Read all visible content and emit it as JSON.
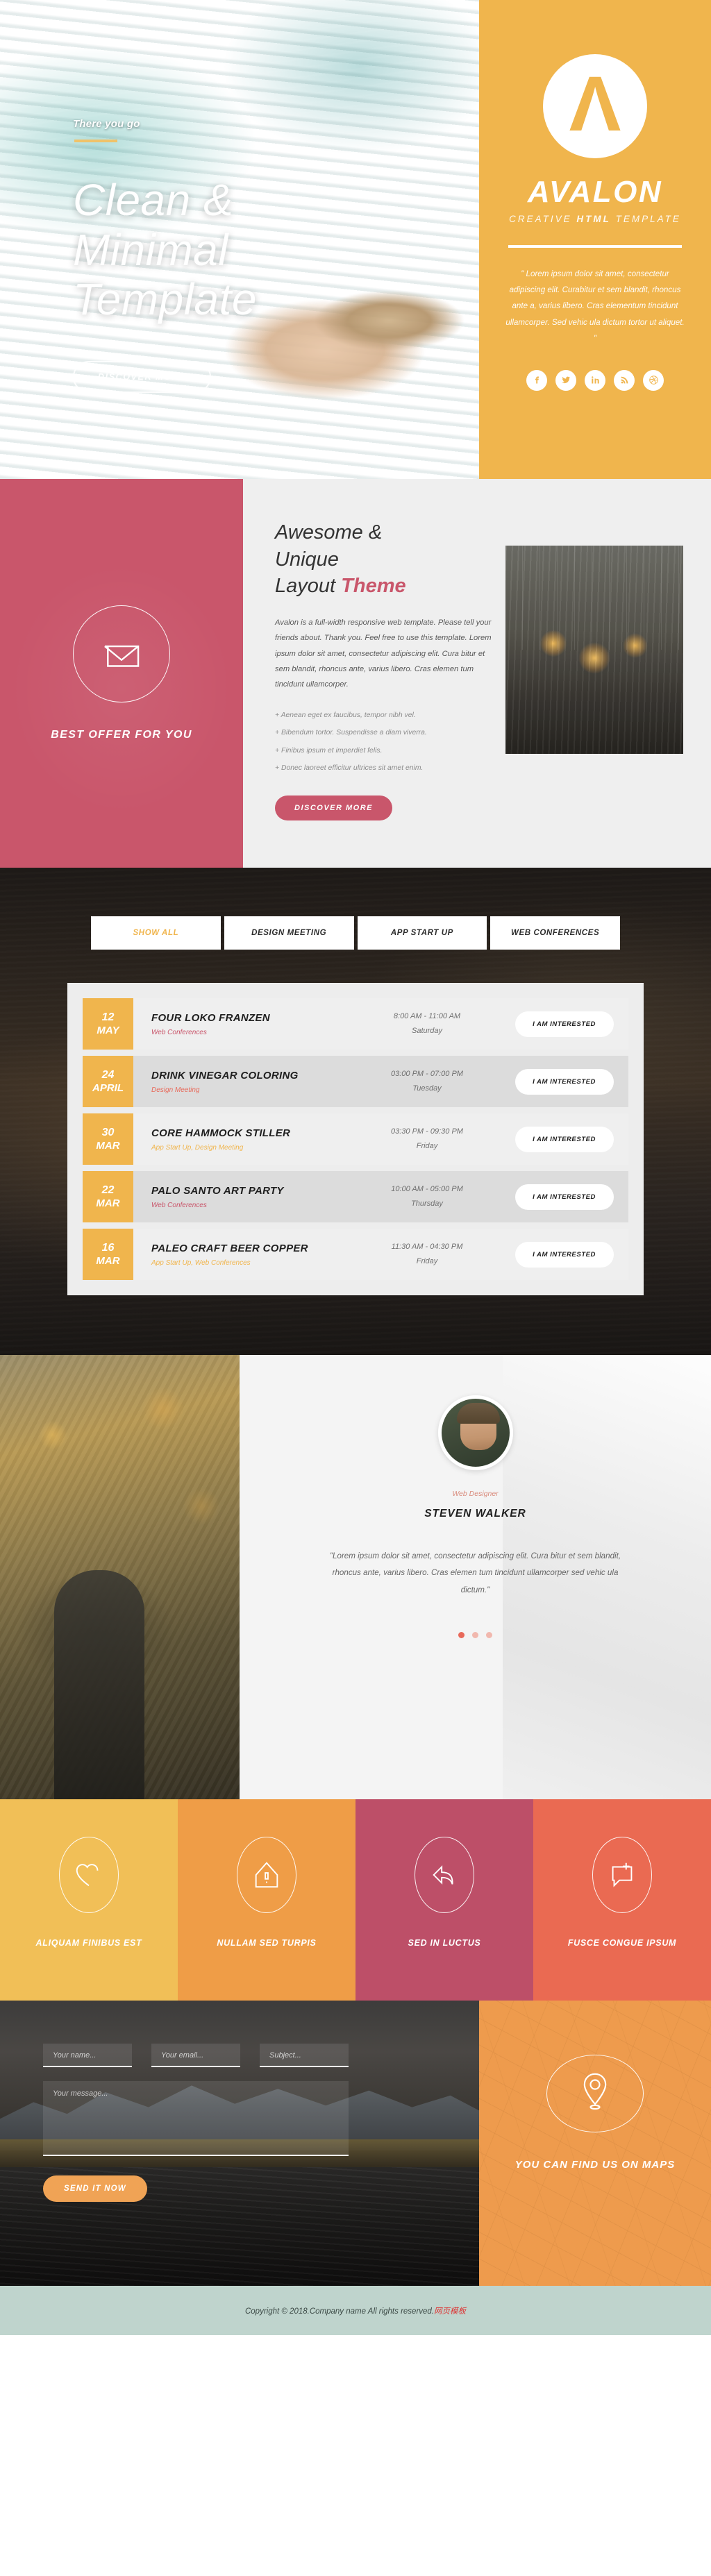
{
  "hero": {
    "eyebrow": "There you go",
    "title": "Clean & Minimal Template",
    "cta": "DISCOVER MORE"
  },
  "brand": {
    "logo_letter": "Λ",
    "name": "AVALON",
    "tagline_pre": "CREATIVE ",
    "tagline_strong": "HTML",
    "tagline_post": " TEMPLATE",
    "quote": "\" Lorem ipsum dolor sit amet, consectetur adipiscing elit. Curabitur et sem blandit, rhoncus ante a, varius libero. Cras elementum tincidunt ullamcorper. Sed vehic ula dictum tortor ut aliquet. \"",
    "socials": [
      {
        "name": "facebook",
        "glyph": "f"
      },
      {
        "name": "twitter",
        "glyph": "t"
      },
      {
        "name": "linkedin",
        "glyph": "in"
      },
      {
        "name": "rss",
        "glyph": "r"
      },
      {
        "name": "dribbble",
        "glyph": "d"
      }
    ],
    "accent_color": "#f0b54d"
  },
  "feature": {
    "offer_label": "BEST OFFER FOR YOU",
    "offer_color": "#c9566b",
    "heading_line1": "Awesome &",
    "heading_line2": "Unique",
    "heading_line3_plain": "Layout ",
    "heading_line3_accent": "Theme",
    "paragraph": "Avalon is a full-width responsive web template. Please tell your friends about. Thank you. Feel free to use this template. Lorem ipsum dolor sit amet, consectetur adipiscing elit. Cura bitur et sem blandit, rhoncus ante, varius libero. Cras elemen tum tincidunt ullamcorper.",
    "bullets": [
      "Aenean eget ex faucibus, tempor nibh vel.",
      "Bibendum tortor. Suspendisse a diam viverra.",
      "Finibus ipsum et  imperdiet felis.",
      "Donec laoreet efficitur ultrices sit amet enim."
    ],
    "cta": "DISCOVER MORE"
  },
  "events": {
    "tabs": [
      {
        "label": "SHOW ALL",
        "active": true
      },
      {
        "label": "DESIGN MEETING",
        "active": false
      },
      {
        "label": "APP START UP",
        "active": false
      },
      {
        "label": "WEB CONFERENCES",
        "active": false
      }
    ],
    "cta_label": "I AM INTERESTED",
    "rows": [
      {
        "day": "12",
        "month": "MAY",
        "name": "FOUR LOKO FRANZEN",
        "category": "Web Conferences",
        "cat_color": "#c9566b",
        "time": "8:00 AM - 11:00 AM",
        "weekday": "Saturday"
      },
      {
        "day": "24",
        "month": "APRIL",
        "name": "DRINK VINEGAR COLORING",
        "category": "Design Meeting",
        "cat_color": "#e8695a",
        "time": "03:00 PM - 07:00 PM",
        "weekday": "Tuesday"
      },
      {
        "day": "30",
        "month": "MAR",
        "name": "CORE HAMMOCK STILLER",
        "category": "App Start Up, Design Meeting",
        "cat_color": "#f0b54d",
        "time": "03:30 PM - 09:30 PM",
        "weekday": "Friday"
      },
      {
        "day": "22",
        "month": "MAR",
        "name": "PALO SANTO ART PARTY",
        "category": "Web Conferences",
        "cat_color": "#c9566b",
        "time": "10:00 AM - 05:00 PM",
        "weekday": "Thursday"
      },
      {
        "day": "16",
        "month": "MAR",
        "name": "PALEO CRAFT BEER COPPER",
        "category": "App Start Up, Web Conferences",
        "cat_color": "#f0b54d",
        "time": "11:30 AM - 04:30 PM",
        "weekday": "Friday"
      }
    ]
  },
  "testimonial": {
    "role": "Web Designer",
    "name": "STEVEN WALKER",
    "quote": "\"Lorem ipsum dolor sit amet, consectetur adipiscing elit. Cura bitur et sem blandit, rhoncus ante, varius libero. Cras elemen tum tincidunt ullamcorper sed vehic ula dictum.\"",
    "slide_count": 3,
    "active_slide": 1
  },
  "services": [
    {
      "label": "ALIQUAM FINIBUS EST",
      "icon": "heart-icon",
      "color": "#f1bf57"
    },
    {
      "label": "NULLAM SED TURPIS",
      "icon": "home-icon",
      "color": "#ef9d47"
    },
    {
      "label": "SED IN LUCTUS",
      "icon": "reply-icon",
      "color": "#bd4f68"
    },
    {
      "label": "FUSCE CONGUE IPSUM",
      "icon": "comment-add-icon",
      "color": "#ea6a52"
    }
  ],
  "contact": {
    "name_placeholder": "Your name...",
    "email_placeholder": "Your email...",
    "subject_placeholder": "Subject...",
    "message_placeholder": "Your message...",
    "submit_label": "SEND IT NOW",
    "map_label": "YOU CAN FIND US ON MAPS",
    "map_color": "#ee9b4d"
  },
  "footer": {
    "copyright": "Copyright © 2018.Company name All rights reserved.",
    "suffix": "网页模板"
  }
}
